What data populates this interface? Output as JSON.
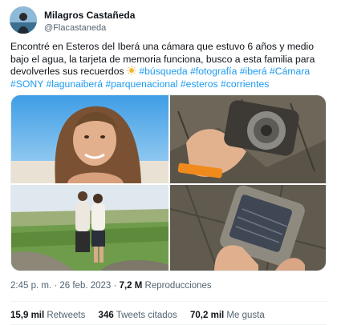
{
  "author": {
    "name": "Milagros Castañeda",
    "handle": "@Flacastaneda"
  },
  "tweet": {
    "text_parts": [
      {
        "t": "Encontré en Esteros del Iberá una cámara que estuvo 6 años y medio bajo el agua, la tarjeta de memoria funciona, busco a esta familia para devolverles sus recuerdos ",
        "kind": "plain"
      },
      {
        "t": "sun-icon",
        "kind": "emoji"
      },
      {
        "t": " ",
        "kind": "plain"
      },
      {
        "t": "#búsqueda",
        "kind": "tag"
      },
      {
        "t": " ",
        "kind": "plain"
      },
      {
        "t": "#fotografía",
        "kind": "tag"
      },
      {
        "t": " ",
        "kind": "plain"
      },
      {
        "t": "#iberá",
        "kind": "tag"
      },
      {
        "t": " ",
        "kind": "plain"
      },
      {
        "t": "#Cámara",
        "kind": "tag"
      },
      {
        "t": " ",
        "kind": "plain"
      },
      {
        "t": "#SONY",
        "kind": "tag"
      },
      {
        "t": " ",
        "kind": "plain"
      },
      {
        "t": "#lagunaiberá",
        "kind": "tag"
      },
      {
        "t": " ",
        "kind": "plain"
      },
      {
        "t": "#parquenacional",
        "kind": "tag"
      },
      {
        "t": " ",
        "kind": "plain"
      },
      {
        "t": "#esteros",
        "kind": "tag"
      },
      {
        "t": " ",
        "kind": "plain"
      },
      {
        "t": "#corrientes",
        "kind": "tag"
      }
    ]
  },
  "media": {
    "photos": [
      "photo-woman-smiling",
      "photo-camera-in-hand",
      "photo-couple-landscape",
      "photo-camera-screen"
    ]
  },
  "meta": {
    "time": "2:45 p. m.",
    "separator": " · ",
    "date": "26 feb. 2023",
    "views_value": "7,2 M",
    "views_label": "Reproducciones"
  },
  "stats": {
    "retweets_value": "15,9 mil",
    "retweets_label": "Retweets",
    "quotes_value": "346",
    "quotes_label": "Tweets citados",
    "likes_value": "70,2 mil",
    "likes_label": "Me gusta"
  },
  "colors": {
    "link": "#1d9bf0",
    "text": "#0f1419",
    "secondary": "#536471"
  }
}
